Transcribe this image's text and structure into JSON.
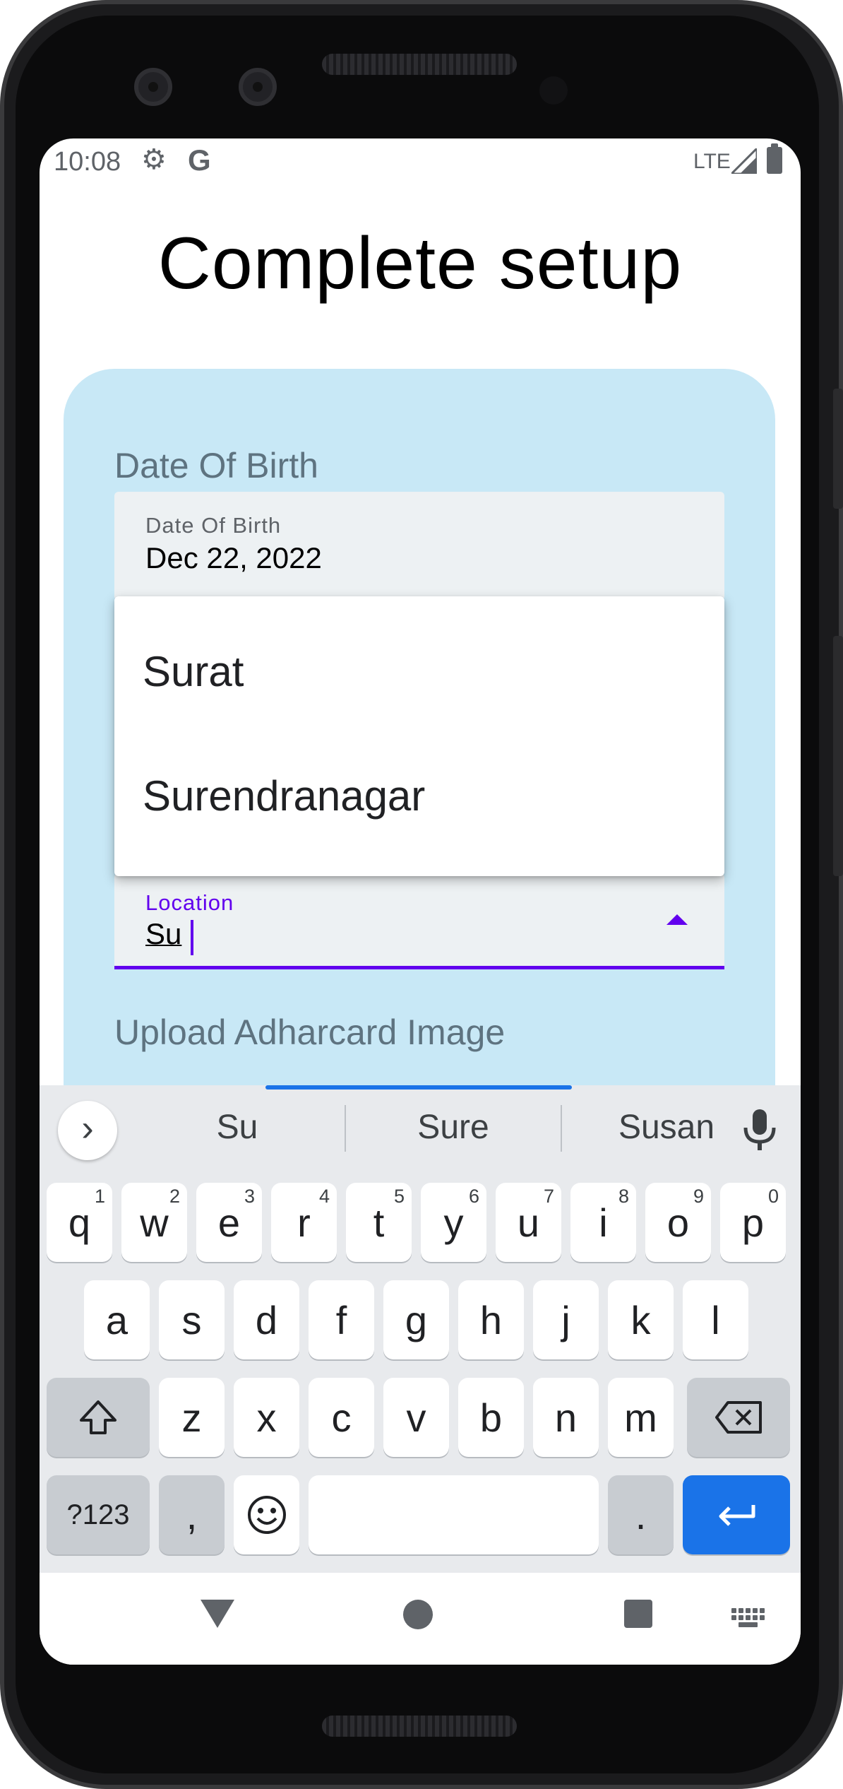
{
  "status_bar": {
    "time": "10:08",
    "network": "LTE",
    "icons": [
      "gear-icon",
      "google-icon",
      "signal-icon",
      "battery-icon"
    ]
  },
  "page": {
    "title": "Complete setup"
  },
  "form": {
    "dob_section_label": "Date Of Birth",
    "dob_field": {
      "caption": "Date Of Birth",
      "value": "Dec 22, 2022"
    },
    "location_field": {
      "caption": "Location",
      "value": "Su"
    },
    "upload_section_label": "Upload Adharcard Image"
  },
  "dropdown": {
    "options": [
      "Surat",
      "Surendranagar"
    ]
  },
  "keyboard": {
    "suggestions": [
      "Su",
      "Sure",
      "Susan"
    ],
    "row1": [
      "q",
      "w",
      "e",
      "r",
      "t",
      "y",
      "u",
      "i",
      "o",
      "p"
    ],
    "row1_numbers": [
      "1",
      "2",
      "3",
      "4",
      "5",
      "6",
      "7",
      "8",
      "9",
      "0"
    ],
    "row2": [
      "a",
      "s",
      "d",
      "f",
      "g",
      "h",
      "j",
      "k",
      "l"
    ],
    "row3": [
      "z",
      "x",
      "c",
      "v",
      "b",
      "n",
      "m"
    ],
    "symbols_key": "?123",
    "comma_key": ",",
    "period_key": "."
  },
  "colors": {
    "accent": "#6200ee",
    "card_background": "#c8e8f6",
    "enter_key": "#1a73e8"
  }
}
